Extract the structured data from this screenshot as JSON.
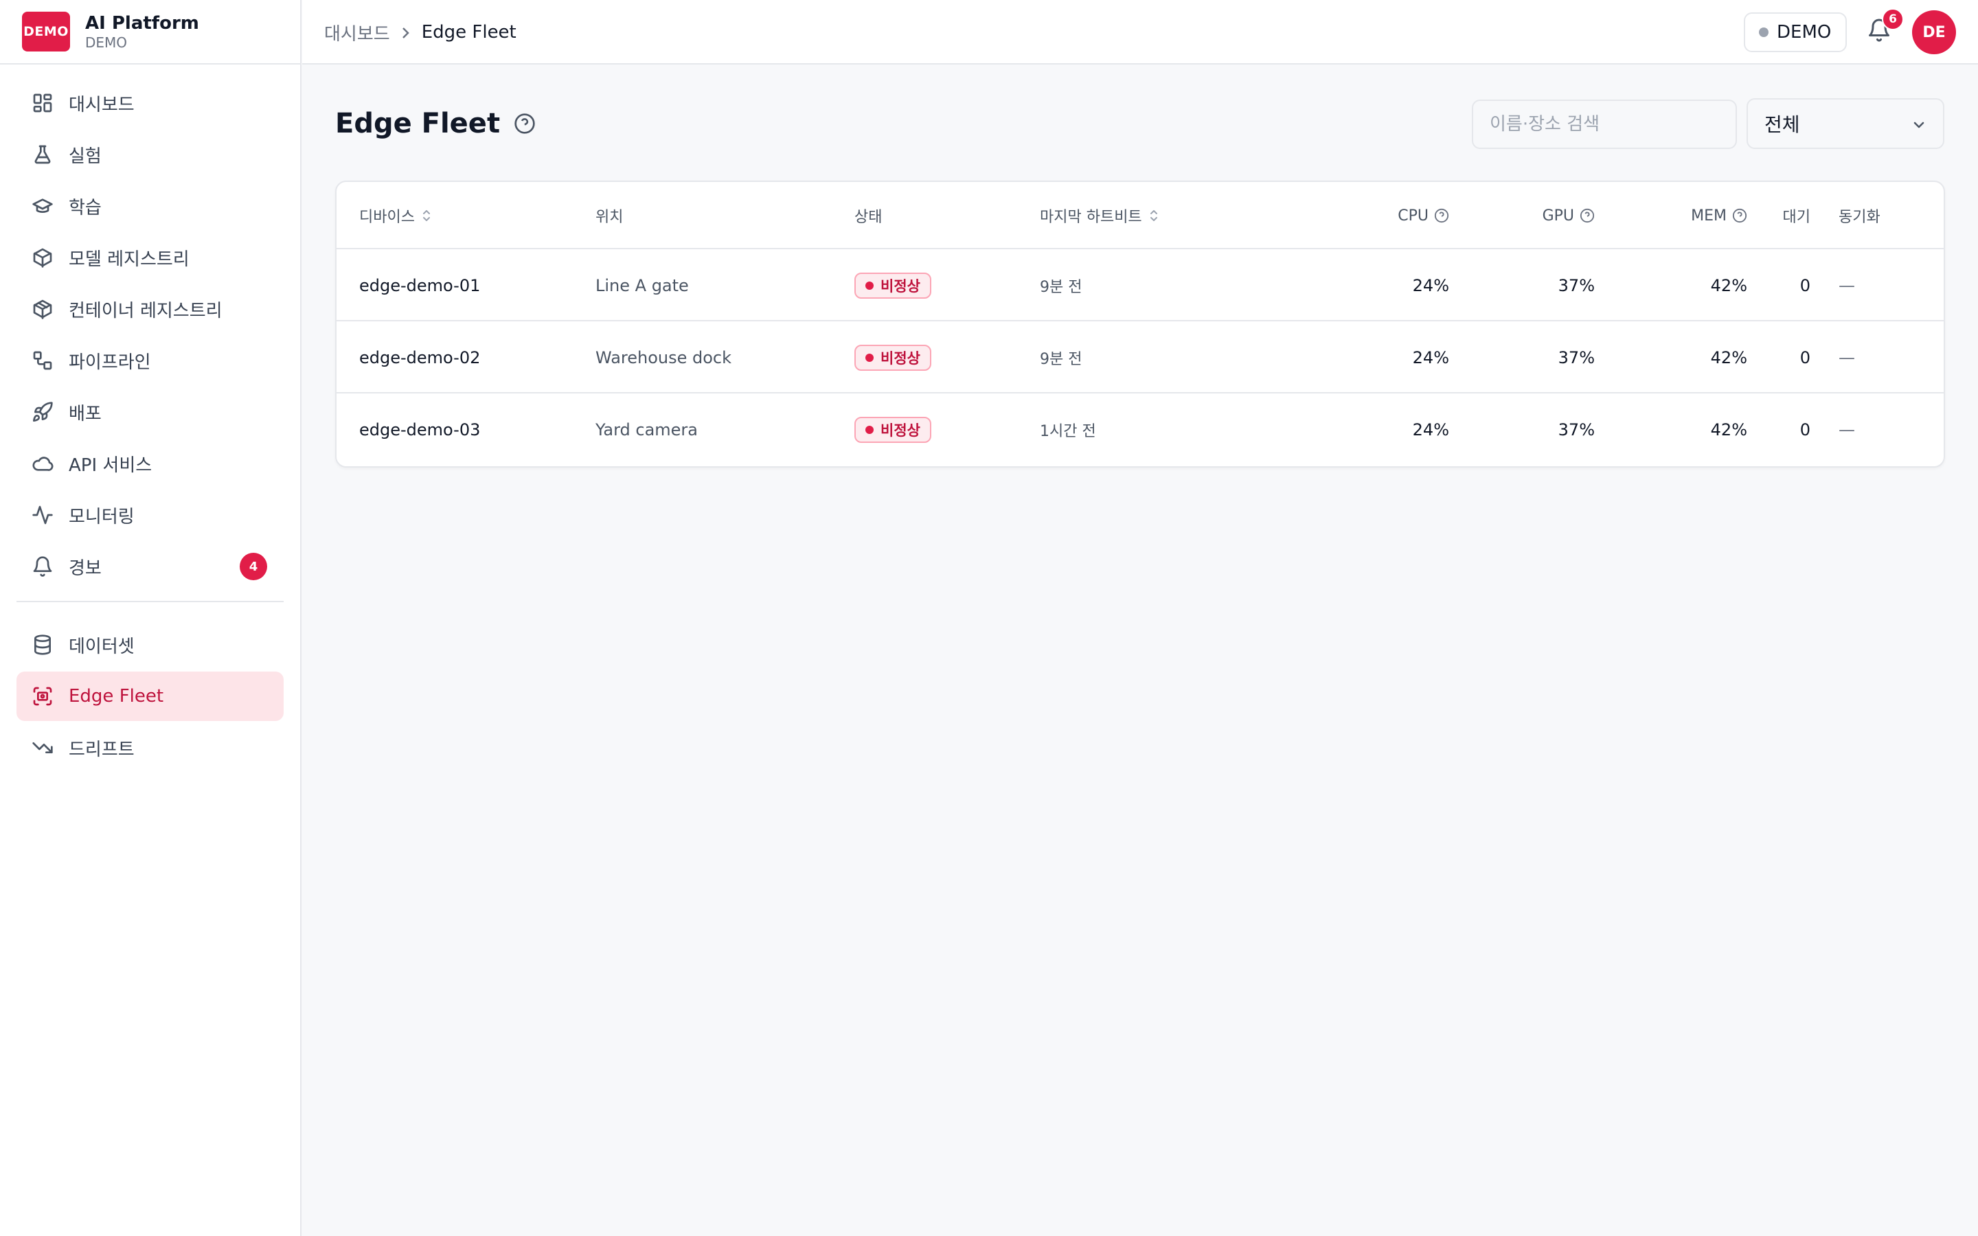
{
  "brand": {
    "logo": "DEMO",
    "title": "AI Platform",
    "subtitle": "DEMO"
  },
  "sidebar": {
    "items": [
      {
        "label": "대시보드",
        "icon": "dashboard-icon"
      },
      {
        "label": "실험",
        "icon": "flask-icon"
      },
      {
        "label": "학습",
        "icon": "graduation-cap-icon"
      },
      {
        "label": "모델 레지스트리",
        "icon": "cube-icon"
      },
      {
        "label": "컨테이너 레지스트리",
        "icon": "package-icon"
      },
      {
        "label": "파이프라인",
        "icon": "workflow-icon"
      },
      {
        "label": "배포",
        "icon": "rocket-icon"
      },
      {
        "label": "API 서비스",
        "icon": "cloud-icon"
      },
      {
        "label": "모니터링",
        "icon": "activity-icon"
      },
      {
        "label": "경보",
        "icon": "bell-icon",
        "badge": "4"
      }
    ],
    "secondary_items": [
      {
        "label": "데이터셋",
        "icon": "database-icon"
      },
      {
        "label": "Edge Fleet",
        "icon": "edge-device-icon",
        "active": true
      },
      {
        "label": "드리프트",
        "icon": "trending-down-icon"
      }
    ]
  },
  "header": {
    "breadcrumb": {
      "home": "대시보드",
      "current": "Edge Fleet"
    },
    "env_label": "DEMO",
    "notifications_count": "6",
    "avatar_initials": "DE"
  },
  "main": {
    "title": "Edge Fleet",
    "search_placeholder": "이름·장소 검색",
    "filter_value": "전체",
    "table": {
      "columns": {
        "device": "디바이스",
        "location": "위치",
        "status": "상태",
        "heartbeat": "마지막 하트비트",
        "cpu": "CPU",
        "gpu": "GPU",
        "mem": "MEM",
        "queue": "대기",
        "sync": "동기화"
      },
      "rows": [
        {
          "device": "edge-demo-01",
          "location": "Line A gate",
          "status": "비정상",
          "heartbeat": "9분 전",
          "cpu": "24%",
          "gpu": "37%",
          "mem": "42%",
          "queue": "0",
          "sync": "—"
        },
        {
          "device": "edge-demo-02",
          "location": "Warehouse dock",
          "status": "비정상",
          "heartbeat": "9분 전",
          "cpu": "24%",
          "gpu": "37%",
          "mem": "42%",
          "queue": "0",
          "sync": "—"
        },
        {
          "device": "edge-demo-03",
          "location": "Yard camera",
          "status": "비정상",
          "heartbeat": "1시간 전",
          "cpu": "24%",
          "gpu": "37%",
          "mem": "42%",
          "queue": "0",
          "sync": "—"
        }
      ]
    }
  },
  "colors": {
    "accent": "#e11d48",
    "active_bg": "#fde4e8",
    "active_text": "#be123c",
    "status_bg": "#fdecef"
  }
}
